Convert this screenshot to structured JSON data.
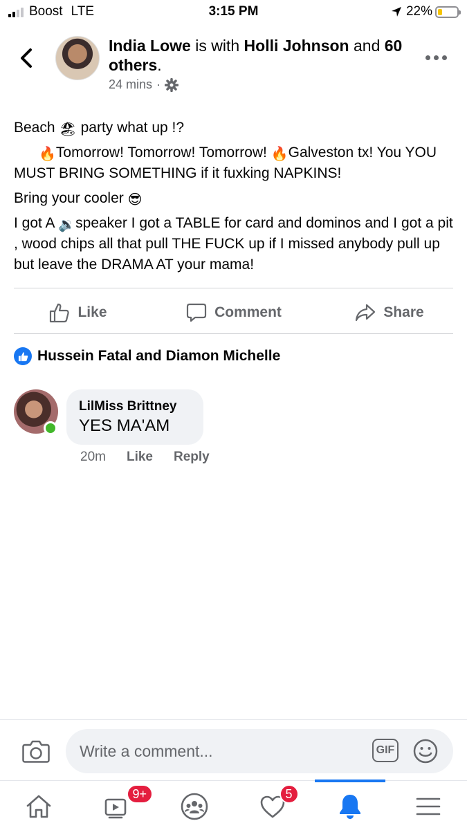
{
  "status_bar": {
    "carrier": "Boost",
    "network": "LTE",
    "time": "3:15 PM",
    "battery": "22%",
    "battery_level": 0.22
  },
  "header": {
    "author": "India Lowe",
    "is_with": " is with ",
    "tagged": "Holli Johnson",
    "and": " and ",
    "others": "60 others",
    "period": ".",
    "time_ago": "24 mins",
    "separator": "·",
    "privacy_icon": "gear-icon"
  },
  "post": {
    "lines": [
      {
        "a": "Beach ",
        "emoji": "🏖",
        "b": " party what up !?"
      },
      {
        "pre_emoji": "🔥",
        "a": "Tomorrow! Tomorrow! Tomorrow! ",
        "emoji": "🔥",
        "b": "Galveston tx! You YOU MUST BRING SOMETHING if it fuxking NAPKINS!"
      },
      {
        "a": "Bring your cooler ",
        "emoji": "😎"
      },
      {
        "a": "I got A ",
        "emoji": "🔉",
        "b": "speaker I got a TABLE for card and dominos and I got a pit , wood chips all that pull THE FUCK up if I missed anybody pull up but leave the DRAMA AT your mama!"
      }
    ]
  },
  "actions": {
    "like": "Like",
    "comment": "Comment",
    "share": "Share"
  },
  "reactions": {
    "names": "Hussein Fatal and Diamon Michelle"
  },
  "comments": [
    {
      "author": "LilMiss Brittney",
      "text": "YES MA'AM",
      "time": "20m",
      "like": "Like",
      "reply": "Reply"
    }
  ],
  "composer": {
    "placeholder": "Write a comment...",
    "gif": "GIF"
  },
  "nav": {
    "watch_badge": "9+",
    "dating_badge": "5",
    "active": "notifications"
  },
  "colors": {
    "accent": "#1877f2",
    "badge": "#e41e3f",
    "online": "#42b72a",
    "muted": "#65676b"
  }
}
